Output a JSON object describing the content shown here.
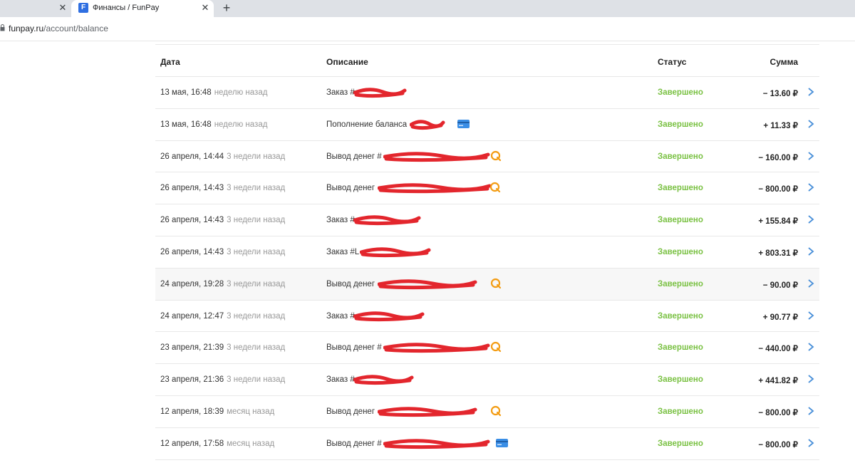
{
  "browser": {
    "inactive_tab_close": "✕",
    "active_tab": {
      "favicon": "F",
      "title": "Финансы / FunPay",
      "close": "✕"
    },
    "new_tab": "+",
    "url_host": "funpay.ru",
    "url_path": "/account/balance"
  },
  "table": {
    "headers": {
      "date": "Дата",
      "description": "Описание",
      "status": "Статус",
      "amount": "Сумма"
    },
    "rows": [
      {
        "date": "13 мая, 16:48",
        "ago": "неделю назад",
        "description": "Заказ #",
        "status": "Завершено",
        "amount": "− 13.60 ₽",
        "method": ""
      },
      {
        "date": "13 мая, 16:48",
        "ago": "неделю назад",
        "description": "Пополнение баланса",
        "status": "Завершено",
        "amount": "+ 11.33 ₽",
        "method": "card"
      },
      {
        "date": "26 апреля, 14:44",
        "ago": "3 недели назад",
        "description": "Вывод денег #",
        "status": "Завершено",
        "amount": "− 160.00 ₽",
        "method": "qiwi"
      },
      {
        "date": "26 апреля, 14:43",
        "ago": "3 недели назад",
        "description": "Вывод денег",
        "status": "Завершено",
        "amount": "− 800.00 ₽",
        "method": "qiwi"
      },
      {
        "date": "26 апреля, 14:43",
        "ago": "3 недели назад",
        "description": "Заказ #",
        "status": "Завершено",
        "amount": "+ 155.84 ₽",
        "method": ""
      },
      {
        "date": "26 апреля, 14:43",
        "ago": "3 недели назад",
        "description": "Заказ #L",
        "status": "Завершено",
        "amount": "+ 803.31 ₽",
        "method": ""
      },
      {
        "date": "24 апреля, 19:28",
        "ago": "3 недели назад",
        "description": "Вывод денег",
        "status": "Завершено",
        "amount": "− 90.00 ₽",
        "method": "qiwi"
      },
      {
        "date": "24 апреля, 12:47",
        "ago": "3 недели назад",
        "description": "Заказ #",
        "status": "Завершено",
        "amount": "+ 90.77 ₽",
        "method": ""
      },
      {
        "date": "23 апреля, 21:39",
        "ago": "3 недели назад",
        "description": "Вывод денег #",
        "status": "Завершено",
        "amount": "− 440.00 ₽",
        "method": "qiwi"
      },
      {
        "date": "23 апреля, 21:36",
        "ago": "3 недели назад",
        "description": "Заказ #",
        "status": "Завершено",
        "amount": "+ 441.82 ₽",
        "method": ""
      },
      {
        "date": "12 апреля, 18:39",
        "ago": "месяц назад",
        "description": "Вывод денег",
        "status": "Завершено",
        "amount": "− 800.00 ₽",
        "method": "qiwi"
      },
      {
        "date": "12 апреля, 17:58",
        "ago": "месяц назад",
        "description": "Вывод денег #",
        "status": "Завершено",
        "amount": "− 800.00 ₽",
        "method": "card"
      }
    ]
  },
  "colors": {
    "status_green": "#7ac143",
    "chevron_blue": "#4a90d9",
    "qiwi_orange": "#f39c12",
    "card_blue": "#3a8ee6",
    "redaction": "#e3262d"
  }
}
